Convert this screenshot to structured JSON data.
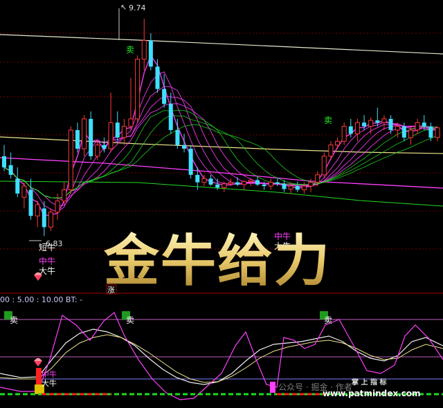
{
  "upper_panel": {
    "high_marker": "9.74",
    "low_marker": "6.83",
    "low_marker_prefix": "短牛",
    "sell_labels": [
      "卖",
      "卖"
    ],
    "mid_bull_labels": [
      "中牛",
      "中牛"
    ],
    "big_bull_labels": [
      "大牛",
      "大牛"
    ],
    "watermark": "金牛给力",
    "bottom_mark": "涨"
  },
  "lower_panel": {
    "params_text": "00 : 5.00 : 10.00  BT: -",
    "sell_labels": [
      "卖",
      "卖",
      "卖"
    ],
    "mid_bull_label": "中牛",
    "big_bull_label": "大牛",
    "credit_text": "公众号 · 掘金 · 作者",
    "credit_site": "www.patmindex.com",
    "credit_brand": "掌 上 指 标"
  },
  "colors": {
    "background": "#000000",
    "up_candle": "#ff3b3b",
    "down_candle": "#3fe0ff",
    "magenta": "#ff40ff",
    "yellow_line": "#f0e68c",
    "green_line": "#22dd22",
    "sell_text": "#22ee22",
    "watermark_gold": "#e8c96a",
    "grid_red": "#7a0000"
  },
  "chart_data": {
    "type": "candlestick",
    "title": "",
    "high": 9.74,
    "low": 6.83,
    "candles": [
      {
        "o": 7.9,
        "h": 8.05,
        "l": 7.7,
        "c": 7.75
      },
      {
        "o": 7.78,
        "h": 7.95,
        "l": 7.6,
        "c": 7.65
      },
      {
        "o": 7.6,
        "h": 7.75,
        "l": 7.35,
        "c": 7.4
      },
      {
        "o": 7.35,
        "h": 7.55,
        "l": 7.2,
        "c": 7.5
      },
      {
        "o": 7.45,
        "h": 7.6,
        "l": 7.05,
        "c": 7.1
      },
      {
        "o": 7.1,
        "h": 7.3,
        "l": 6.95,
        "c": 7.25
      },
      {
        "o": 7.2,
        "h": 7.3,
        "l": 6.83,
        "c": 6.95
      },
      {
        "o": 6.95,
        "h": 7.2,
        "l": 6.9,
        "c": 7.15
      },
      {
        "o": 7.15,
        "h": 7.4,
        "l": 7.05,
        "c": 7.3
      },
      {
        "o": 7.3,
        "h": 7.55,
        "l": 7.25,
        "c": 7.45
      },
      {
        "o": 7.45,
        "h": 8.3,
        "l": 7.4,
        "c": 8.25
      },
      {
        "o": 8.25,
        "h": 8.35,
        "l": 7.95,
        "c": 8.0
      },
      {
        "o": 8.0,
        "h": 8.45,
        "l": 7.9,
        "c": 8.4
      },
      {
        "o": 8.4,
        "h": 8.5,
        "l": 7.85,
        "c": 7.9
      },
      {
        "o": 7.9,
        "h": 8.1,
        "l": 7.85,
        "c": 8.05
      },
      {
        "o": 8.05,
        "h": 8.15,
        "l": 7.95,
        "c": 8.0
      },
      {
        "o": 8.0,
        "h": 8.75,
        "l": 7.95,
        "c": 8.35
      },
      {
        "o": 8.35,
        "h": 8.5,
        "l": 8.1,
        "c": 8.15
      },
      {
        "o": 8.15,
        "h": 8.4,
        "l": 8.05,
        "c": 8.3
      },
      {
        "o": 8.3,
        "h": 8.95,
        "l": 8.25,
        "c": 8.4
      },
      {
        "o": 8.4,
        "h": 9.25,
        "l": 8.35,
        "c": 9.2
      },
      {
        "o": 9.2,
        "h": 9.74,
        "l": 9.05,
        "c": 9.45
      },
      {
        "o": 9.45,
        "h": 9.55,
        "l": 9.05,
        "c": 9.1
      },
      {
        "o": 9.1,
        "h": 9.2,
        "l": 8.75,
        "c": 8.8
      },
      {
        "o": 8.8,
        "h": 9.0,
        "l": 8.55,
        "c": 8.6
      },
      {
        "o": 8.6,
        "h": 8.75,
        "l": 8.2,
        "c": 8.25
      },
      {
        "o": 8.25,
        "h": 8.4,
        "l": 8.0,
        "c": 8.05
      },
      {
        "o": 8.05,
        "h": 8.2,
        "l": 7.95,
        "c": 8.0
      },
      {
        "o": 8.0,
        "h": 8.05,
        "l": 7.6,
        "c": 7.65
      },
      {
        "o": 7.65,
        "h": 7.75,
        "l": 7.45,
        "c": 7.55
      },
      {
        "o": 7.55,
        "h": 7.65,
        "l": 7.5,
        "c": 7.6
      },
      {
        "o": 7.6,
        "h": 7.65,
        "l": 7.5,
        "c": 7.52
      },
      {
        "o": 7.52,
        "h": 7.6,
        "l": 7.45,
        "c": 7.48
      },
      {
        "o": 7.48,
        "h": 7.56,
        "l": 7.42,
        "c": 7.53
      },
      {
        "o": 7.53,
        "h": 7.6,
        "l": 7.5,
        "c": 7.55
      },
      {
        "o": 7.55,
        "h": 7.62,
        "l": 7.5,
        "c": 7.52
      },
      {
        "o": 7.52,
        "h": 7.58,
        "l": 7.45,
        "c": 7.56
      },
      {
        "o": 7.56,
        "h": 7.6,
        "l": 7.5,
        "c": 7.58
      },
      {
        "o": 7.58,
        "h": 7.62,
        "l": 7.5,
        "c": 7.52
      },
      {
        "o": 7.52,
        "h": 7.56,
        "l": 7.45,
        "c": 7.5
      },
      {
        "o": 7.5,
        "h": 7.6,
        "l": 7.45,
        "c": 7.55
      },
      {
        "o": 7.55,
        "h": 7.6,
        "l": 7.5,
        "c": 7.53
      },
      {
        "o": 7.53,
        "h": 7.58,
        "l": 7.42,
        "c": 7.46
      },
      {
        "o": 7.46,
        "h": 7.55,
        "l": 7.4,
        "c": 7.5
      },
      {
        "o": 7.5,
        "h": 7.56,
        "l": 7.42,
        "c": 7.45
      },
      {
        "o": 7.45,
        "h": 7.55,
        "l": 7.4,
        "c": 7.5
      },
      {
        "o": 7.5,
        "h": 7.6,
        "l": 7.42,
        "c": 7.55
      },
      {
        "o": 7.55,
        "h": 7.7,
        "l": 7.5,
        "c": 7.65
      },
      {
        "o": 7.65,
        "h": 7.95,
        "l": 7.6,
        "c": 7.9
      },
      {
        "o": 7.9,
        "h": 8.1,
        "l": 7.85,
        "c": 8.05
      },
      {
        "o": 8.05,
        "h": 8.15,
        "l": 8.0,
        "c": 8.1
      },
      {
        "o": 8.1,
        "h": 8.35,
        "l": 8.05,
        "c": 8.3
      },
      {
        "o": 8.3,
        "h": 8.4,
        "l": 8.15,
        "c": 8.2
      },
      {
        "o": 8.2,
        "h": 8.4,
        "l": 8.1,
        "c": 8.35
      },
      {
        "o": 8.35,
        "h": 8.45,
        "l": 8.25,
        "c": 8.3
      },
      {
        "o": 8.3,
        "h": 8.42,
        "l": 8.2,
        "c": 8.38
      },
      {
        "o": 8.38,
        "h": 8.55,
        "l": 8.3,
        "c": 8.35
      },
      {
        "o": 8.35,
        "h": 8.45,
        "l": 8.25,
        "c": 8.4
      },
      {
        "o": 8.4,
        "h": 8.45,
        "l": 8.2,
        "c": 8.25
      },
      {
        "o": 8.25,
        "h": 8.35,
        "l": 8.15,
        "c": 8.3
      },
      {
        "o": 8.3,
        "h": 8.35,
        "l": 8.1,
        "c": 8.15
      },
      {
        "o": 8.15,
        "h": 8.3,
        "l": 8.05,
        "c": 8.25
      },
      {
        "o": 8.25,
        "h": 8.4,
        "l": 8.2,
        "c": 8.35
      },
      {
        "o": 8.35,
        "h": 8.45,
        "l": 8.25,
        "c": 8.3
      },
      {
        "o": 8.3,
        "h": 8.35,
        "l": 8.1,
        "c": 8.15
      },
      {
        "o": 8.15,
        "h": 8.3,
        "l": 8.1,
        "c": 8.28
      }
    ]
  }
}
